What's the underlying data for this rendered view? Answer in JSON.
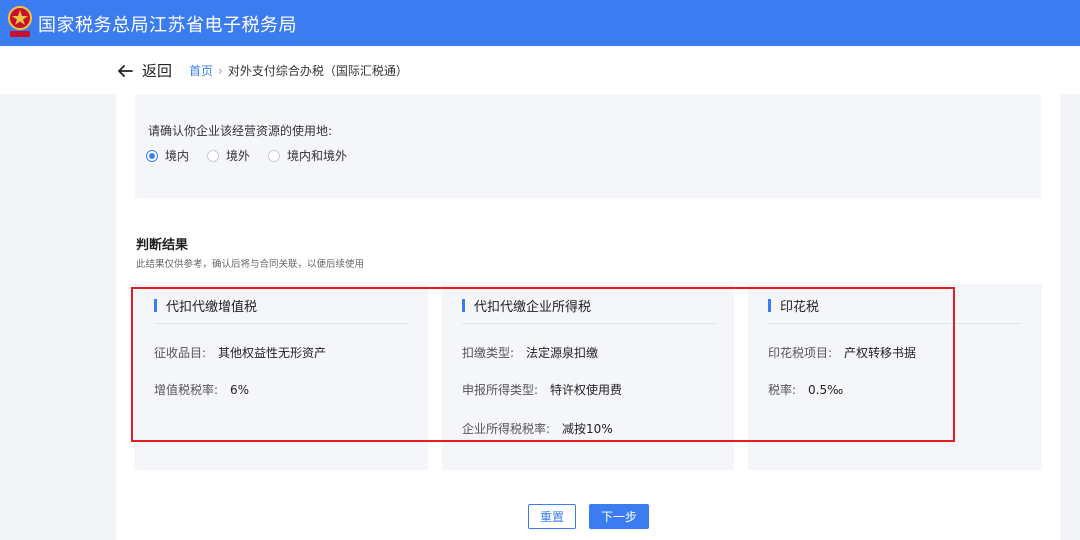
{
  "header": {
    "site_title": "国家税务总局江苏省电子税务局",
    "brand_color": "#3b7df0"
  },
  "nav": {
    "back_label": "返回",
    "breadcrumb": [
      "首页",
      "对外支付综合办税（国际汇税通）"
    ]
  },
  "question": {
    "prompt": "请确认你企业该经营资源的使用地:",
    "options": [
      {
        "label": "境内",
        "checked": true
      },
      {
        "label": "境外",
        "checked": false
      },
      {
        "label": "境内和境外",
        "checked": false
      }
    ]
  },
  "result": {
    "title": "判断结果",
    "note": "此结果仅供参考，确认后将与合同关联，以便后续使用"
  },
  "cards": [
    {
      "title": "代扣代缴增值税",
      "rows": [
        {
          "key": "征收品目:",
          "value": "其他权益性无形资产"
        },
        {
          "key": "增值税税率:",
          "value": "6%"
        }
      ]
    },
    {
      "title": "代扣代缴企业所得税",
      "rows": [
        {
          "key": "扣缴类型:",
          "value": "法定源泉扣缴"
        },
        {
          "key": "申报所得类型:",
          "value": "特许权使用费"
        },
        {
          "key": "企业所得税税率:",
          "value": "减按10%"
        }
      ]
    },
    {
      "title": "印花税",
      "rows": [
        {
          "key": "印花税项目:",
          "value": "产权转移书据"
        },
        {
          "key": "税率:",
          "value": "0.5‰"
        }
      ]
    }
  ],
  "actions": {
    "reset_label": "重置",
    "next_label": "下一步"
  }
}
